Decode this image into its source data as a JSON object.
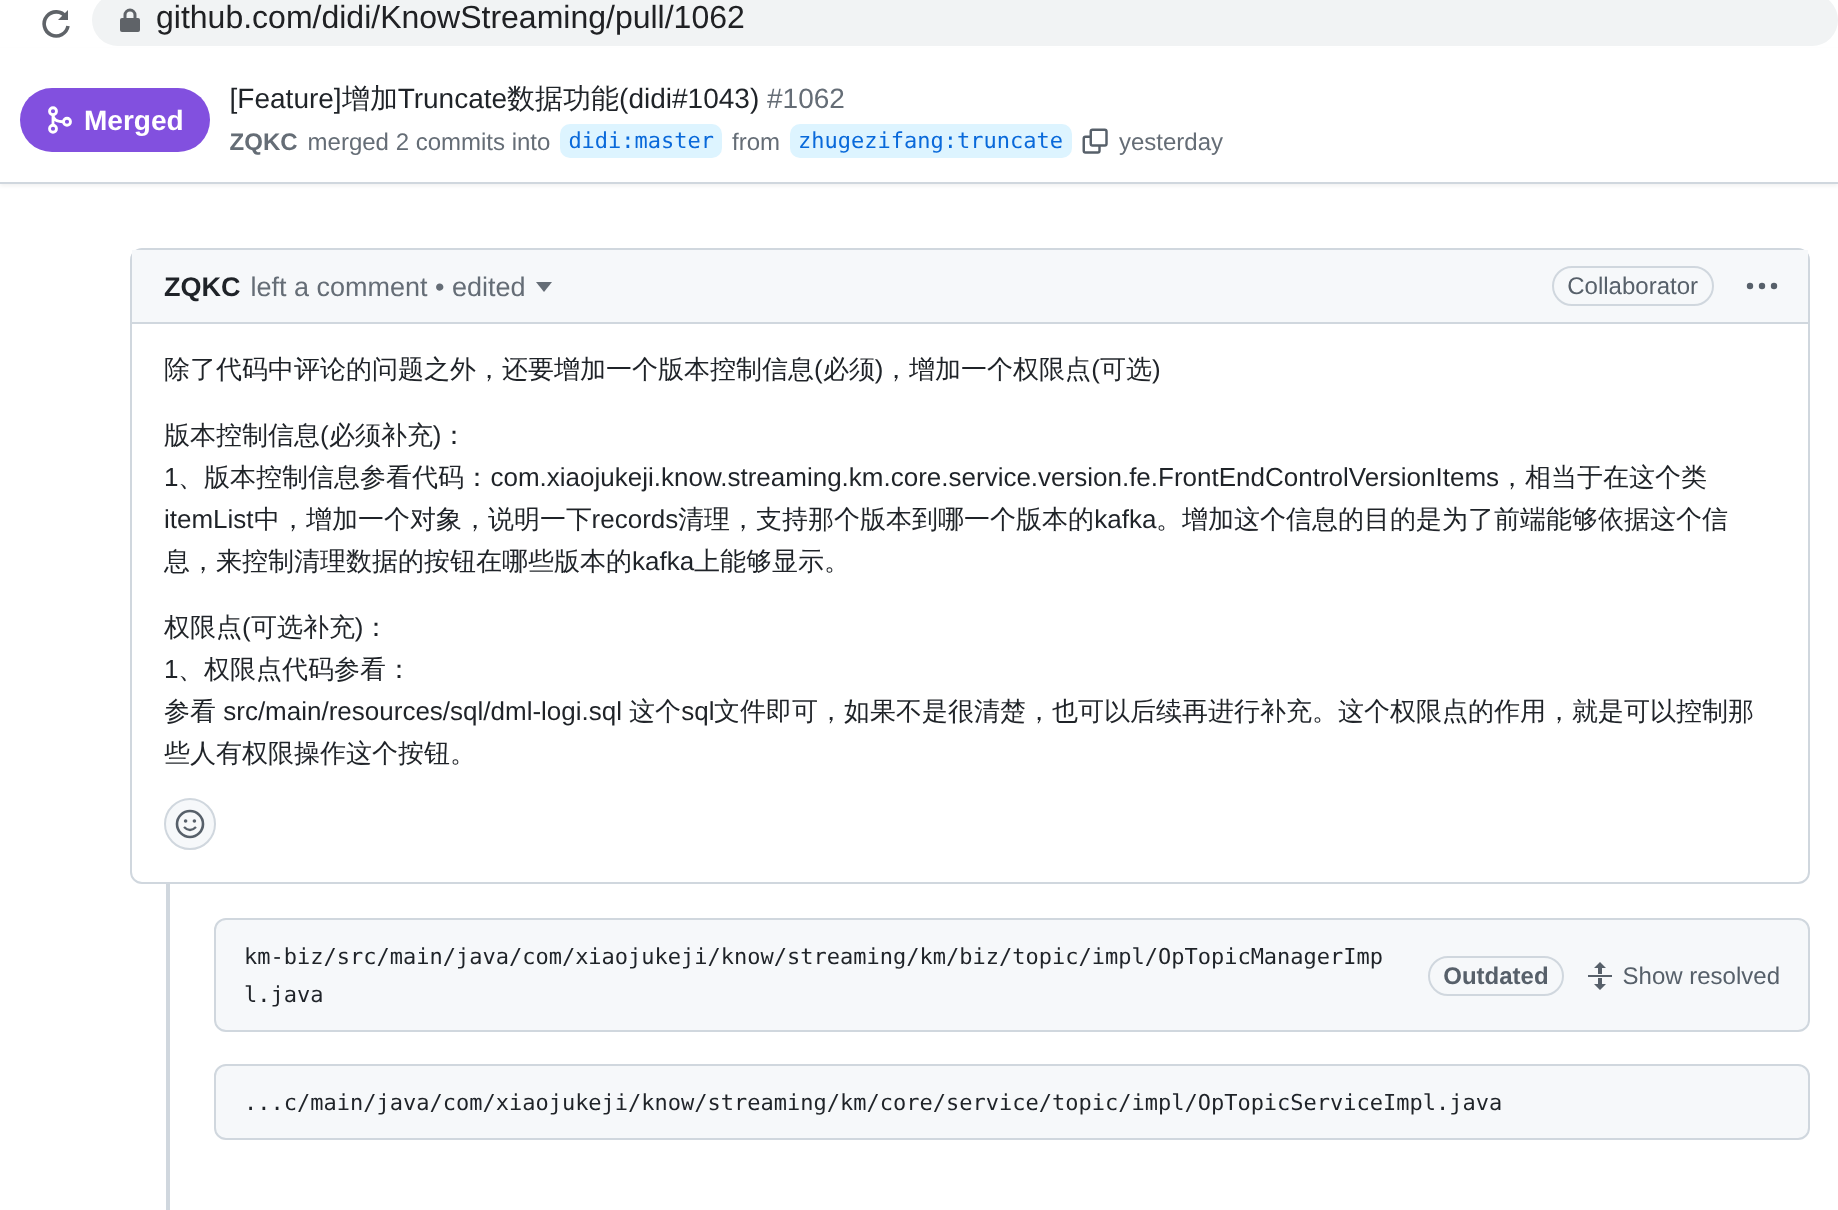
{
  "address_bar": {
    "url": "github.com/didi/KnowStreaming/pull/1062"
  },
  "pr_header": {
    "state": "Merged",
    "title": "[Feature]增加Truncate数据功能(didi#1043)",
    "number": "#1062",
    "author": "ZQKC",
    "action": "merged 2 commits into",
    "base_branch": "didi:master",
    "from_word": "from",
    "head_branch": "zhugezifang:truncate",
    "time": "yesterday"
  },
  "comment": {
    "author": "ZQKC",
    "meta": "left a comment • edited",
    "badge": "Collaborator",
    "paragraphs": [
      [
        "除了代码中评论的问题之外，还要增加一个版本控制信息(必须)，增加一个权限点(可选)"
      ],
      [
        "版本控制信息(必须补充)：",
        "1、版本控制信息参看代码：com.xiaojukeji.know.streaming.km.core.service.version.fe.FrontEndControlVersionItems，相当于在这个类itemList中，增加一个对象，说明一下records清理，支持那个版本到哪一个版本的kafka。增加这个信息的目的是为了前端能够依据这个信息，来控制清理数据的按钮在哪些版本的kafka上能够显示。"
      ],
      [
        "权限点(可选补充)：",
        "1、权限点代码参看：",
        "参看 src/main/resources/sql/dml-logi.sql 这个sql文件即可，如果不是很清楚，也可以后续再进行补充。这个权限点的作用，就是可以控制那些人有权限操作这个按钮。"
      ]
    ]
  },
  "review_threads": [
    {
      "path": "km-biz/src/main/java/com/xiaojukeji/know/streaming/km/biz/topic/impl/OpTopicManagerImpl.java",
      "outdated_label": "Outdated",
      "resolve_label": "Show resolved"
    },
    {
      "path": "...c/main/java/com/xiaojukeji/know/streaming/km/core/service/topic/impl/OpTopicServiceImpl.java"
    }
  ]
}
